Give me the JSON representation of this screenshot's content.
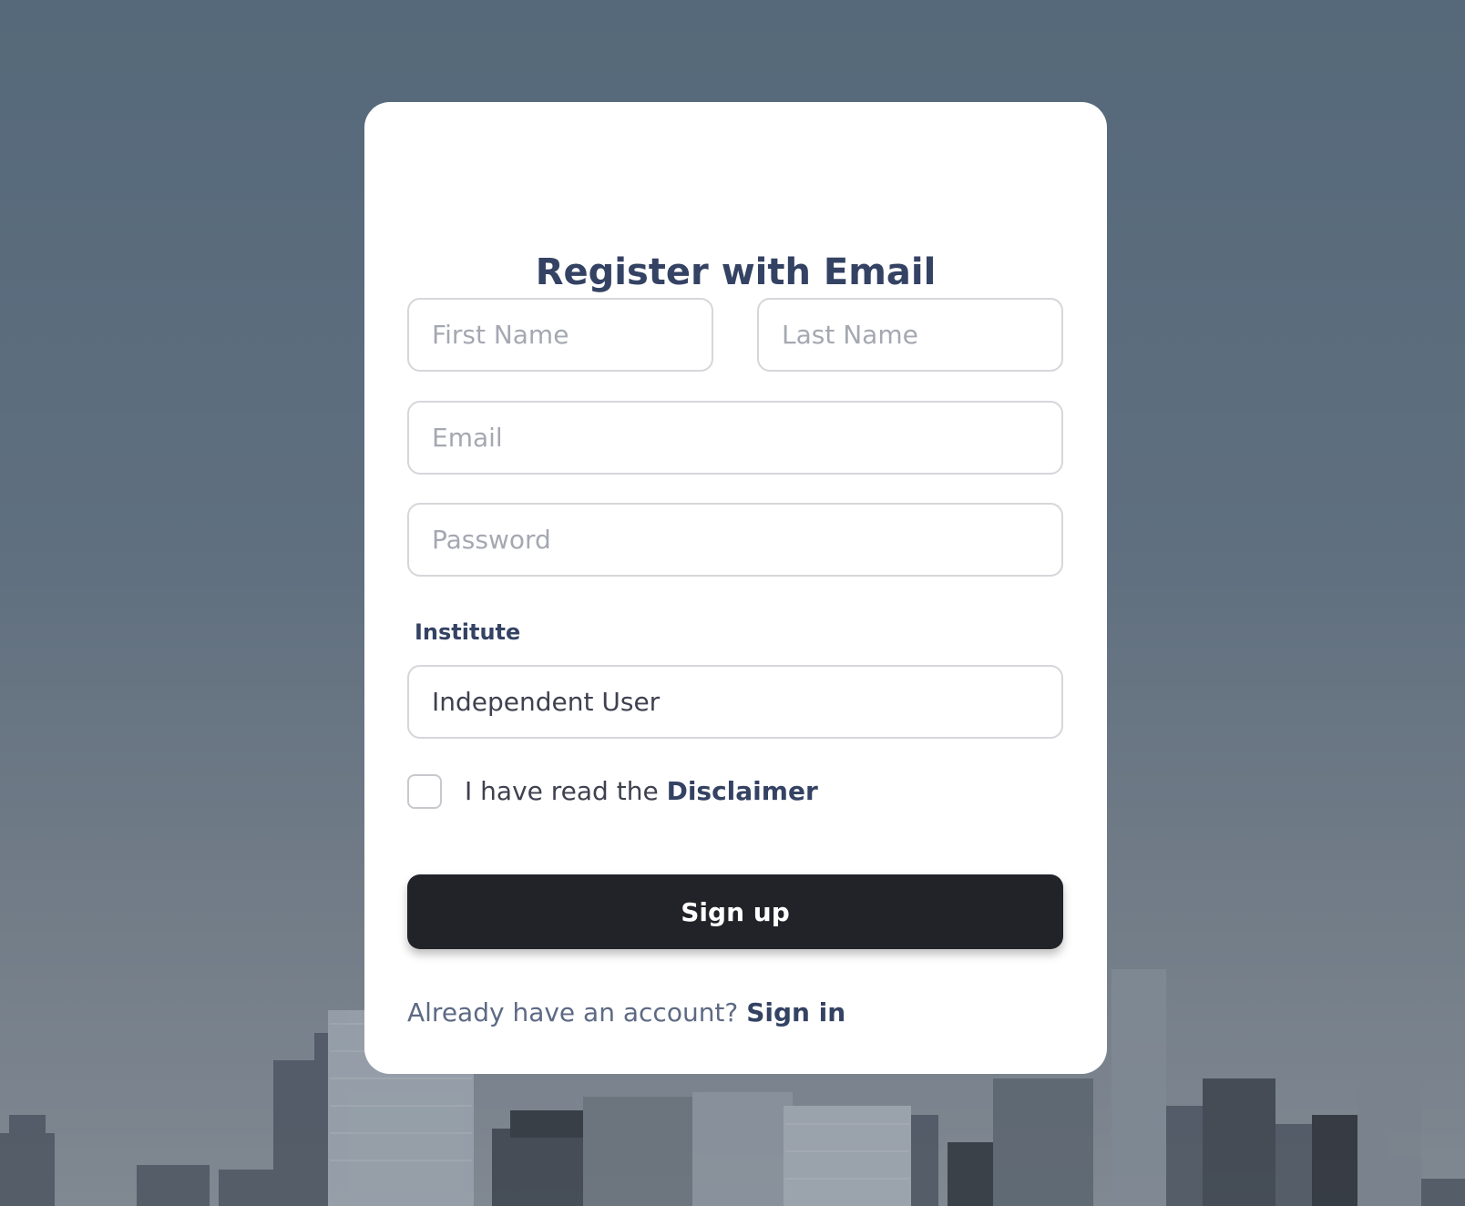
{
  "page": {
    "title": "Register with Email"
  },
  "form": {
    "first_name": {
      "placeholder": "First Name",
      "value": ""
    },
    "last_name": {
      "placeholder": "Last Name",
      "value": ""
    },
    "email": {
      "placeholder": "Email",
      "value": ""
    },
    "password": {
      "placeholder": "Password",
      "value": ""
    },
    "institute_label": "Institute",
    "institute": {
      "value": "Independent User"
    },
    "disclaimer_prefix": "I have read the",
    "disclaimer_link": "Disclaimer",
    "submit_label": "Sign up"
  },
  "footer": {
    "prompt": "Already have an account?",
    "signin_link": "Sign in"
  },
  "colors": {
    "title": "#344263",
    "button_bg": "#222328",
    "button_text": "#ffffff",
    "input_border": "#d6d6db",
    "placeholder": "#a5a8b2"
  }
}
